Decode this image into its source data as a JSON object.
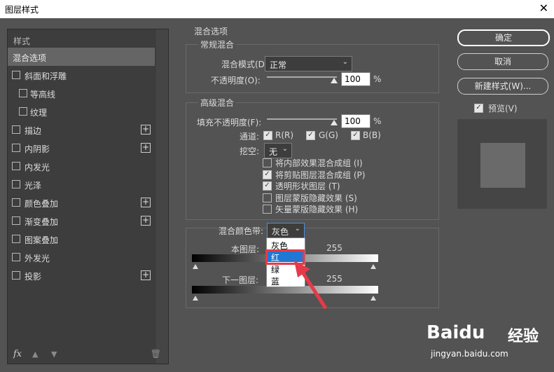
{
  "window": {
    "title": "图层样式",
    "close_glyph": "✕"
  },
  "left_panel": {
    "header": "样式",
    "items": [
      {
        "label": "混合选项",
        "selected": true,
        "has_checkbox": false,
        "has_plus": false
      },
      {
        "label": "斜面和浮雕",
        "has_checkbox": true,
        "has_plus": false
      },
      {
        "label": "等高线",
        "has_checkbox": true,
        "sub": true
      },
      {
        "label": "纹理",
        "has_checkbox": true,
        "sub": true
      },
      {
        "label": "描边",
        "has_checkbox": true,
        "has_plus": true
      },
      {
        "label": "内阴影",
        "has_checkbox": true,
        "has_plus": true
      },
      {
        "label": "内发光",
        "has_checkbox": true,
        "has_plus": false
      },
      {
        "label": "光泽",
        "has_checkbox": true,
        "has_plus": false
      },
      {
        "label": "颜色叠加",
        "has_checkbox": true,
        "has_plus": true
      },
      {
        "label": "渐变叠加",
        "has_checkbox": true,
        "has_plus": true
      },
      {
        "label": "图案叠加",
        "has_checkbox": true,
        "has_plus": false
      },
      {
        "label": "外发光",
        "has_checkbox": true,
        "has_plus": false
      },
      {
        "label": "投影",
        "has_checkbox": true,
        "has_plus": true
      }
    ],
    "fx_label": "fx"
  },
  "blend_options": {
    "section_title": "混合选项",
    "general": {
      "title": "常规混合",
      "mode_label": "混合模式(D):",
      "mode_value": "正常",
      "opacity_label": "不透明度(O):",
      "opacity_value": "100",
      "opacity_unit": "%"
    },
    "advanced": {
      "title": "高级混合",
      "fill_label": "填充不透明度(F):",
      "fill_value": "100",
      "fill_unit": "%",
      "channels_label": "通道:",
      "channels": [
        {
          "label": "R(R)",
          "checked": true
        },
        {
          "label": "G(G)",
          "checked": true
        },
        {
          "label": "B(B)",
          "checked": true
        }
      ],
      "knockout_label": "挖空:",
      "knockout_value": "无",
      "options": [
        {
          "label": "将内部效果混合成组 (I)",
          "checked": false
        },
        {
          "label": "将剪贴图层混合成组 (P)",
          "checked": true
        },
        {
          "label": "透明形状图层 (T)",
          "checked": true
        },
        {
          "label": "图层蒙版隐藏效果 (S)",
          "checked": false
        },
        {
          "label": "矢量蒙版隐藏效果 (H)",
          "checked": false
        }
      ]
    },
    "blend_if": {
      "label": "混合颜色带:",
      "value": "灰色",
      "this_layer_label": "本图层:",
      "this_layer_min": "0",
      "this_layer_max": "255",
      "underlying_label": "下一图层:",
      "underlying_min": "0",
      "underlying_max": "255",
      "menu_options": [
        "灰色",
        "红",
        "绿",
        "蓝"
      ],
      "highlighted_option": "红"
    }
  },
  "right_panel": {
    "ok_label": "确定",
    "cancel_label": "取消",
    "new_style_label": "新建样式(W)...",
    "preview_label": "预览(V)",
    "preview_checked": true
  },
  "watermark": {
    "text_brand": "Baidu",
    "text_cn": "经验",
    "url": "jingyan.baidu.com"
  },
  "colors": {
    "highlight": "#1e78d4",
    "annotation": "#e53a4a"
  }
}
